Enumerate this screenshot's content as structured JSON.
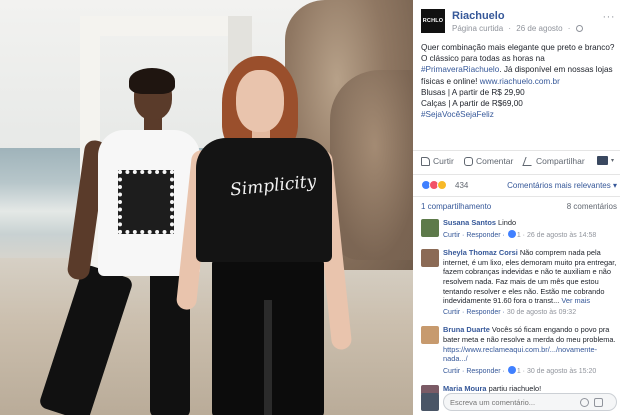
{
  "post": {
    "logo_text": "RCHLO",
    "page_name": "Riachuelo",
    "meta_type": "Página curtida",
    "meta_sep": "·",
    "meta_date": "26 de agosto",
    "meta_sep2": "·",
    "more_label": "···",
    "text_line1": "Quer combinação mais elegante que preto e branco? O clássico para todas as horas na",
    "hashtag1": "#PrimaveraRiachuelo",
    "text_line2": ". Já disponível em nossas lojas físicas e online!",
    "site_link": "www.riachuelo.com.br",
    "blusas": "Blusas | A partir de R$ 29,90",
    "calcas": "Calças | A partir de R$69,00",
    "hashtag2": "#SejaVocêSejaFeliz",
    "print_text": "Simplicity"
  },
  "actions": {
    "like": "Curtir",
    "comment": "Comentar",
    "share": "Compartilhar"
  },
  "reactions": {
    "count": "434",
    "order_label": "Comentários mais relevantes ▾",
    "colors": [
      "#4080ff",
      "#f25268",
      "#f7b928"
    ]
  },
  "shares": {
    "shares_label": "1 compartilhamento",
    "comments_label": "8 comentários"
  },
  "comments": [
    {
      "author": "Susana Santos",
      "text": "Lindo",
      "reply": "Curtir · Responder ·",
      "likes": "1",
      "date": "· 26 de agosto às 14:58",
      "avatar_color": "#5d7a4a"
    },
    {
      "author": "Sheyla Thomaz Corsi",
      "text": "Não comprem nada pela internet, é um lixo, eles demoram muito pra entregar, fazem cobranças indevidas e não te auxiliam e não resolvem nada. Faz mais de um mês que estou tentando resolver e eles não. Estão me cobrando indevidamente 91.60 fora o transt...",
      "see_more": "Ver mais",
      "reply": "Curtir · Responder ·",
      "date": "30 de agosto às 09:32",
      "avatar_color": "#8b6a55"
    },
    {
      "author": "Bruna Duarte",
      "text": "Vocês só ficam engando o povo pra bater meta e não resolve a merda do meu problema.",
      "link": "https://www.reclameaqui.com.br/.../novamente-nada.../",
      "reply": "Curtir · Responder ·",
      "likes": "1",
      "date": "· 30 de agosto às 15:20",
      "avatar_color": "#c79a6e"
    },
    {
      "author": "Maria Moura",
      "text": "partiu riachuelo!",
      "avatar_color": "#7b5b66"
    }
  ],
  "composer": {
    "placeholder": "Escreva um comentário..."
  }
}
